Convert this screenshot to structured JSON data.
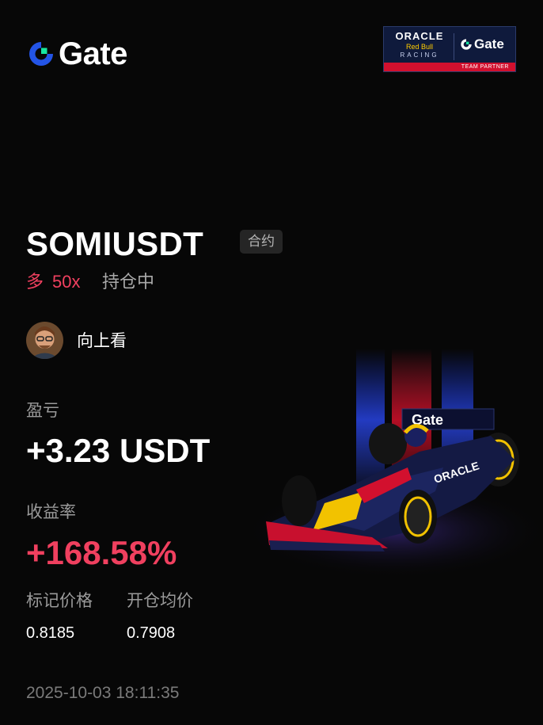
{
  "brand": {
    "name": "Gate"
  },
  "partner_badge": {
    "team": "ORACLE",
    "sponsor": "Red Bull",
    "racing": "RACING",
    "gate": "Gate",
    "label": "TEAM PARTNER"
  },
  "position": {
    "symbol": "SOMIUSDT",
    "market_tag": "合约",
    "side": "多",
    "leverage": "50x",
    "status": "持仓中"
  },
  "user": {
    "name": "向上看"
  },
  "pnl": {
    "label": "盈亏",
    "value": "+3.23 USDT"
  },
  "roi": {
    "label": "收益率",
    "value": "+168.58%"
  },
  "prices": {
    "mark_label": "标记价格",
    "mark_value": "0.8185",
    "entry_label": "开仓均价",
    "entry_value": "0.7908"
  },
  "timestamp": "2025-10-03 18:11:35",
  "colors": {
    "accent_red": "#f0405f",
    "brand_blue": "#2354e6",
    "brand_green": "#17e6a1",
    "background": "#070707"
  }
}
